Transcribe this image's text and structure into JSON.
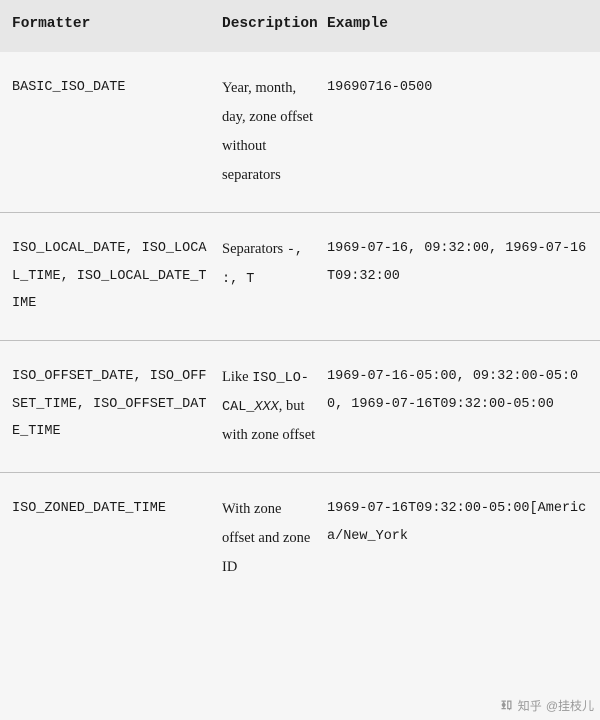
{
  "header": {
    "col1": "Formatter",
    "col2": "Description",
    "col3": "Example"
  },
  "rows": [
    {
      "formatter": "BASIC_ISO_DATE",
      "description_plain": "Year, month, day, zone offset without separators",
      "example": "19690716-0500"
    },
    {
      "formatter": "ISO_LOCAL_DATE, ISO_LOCAL_TIME, ISO_LOCAL_DATE_TIME",
      "desc_prefix": "Separators ",
      "desc_mono": "-, :, T",
      "example": "1969-07-16, 09:32:00, 1969-07-16T09:32:00"
    },
    {
      "formatter": "ISO_OFFSET_DATE, ISO_OFFSET_TIME, ISO_OFFSET_DATE_TIME",
      "desc_prefix": "Like ",
      "desc_mono": "ISO_LO-CAL_",
      "desc_mono_italic": "XXX",
      "desc_suffix": ", but with zone offset",
      "example": "1969-07-16-05:00, 09:32:00-05:00, 1969-07-16T09:32:00-05:00"
    },
    {
      "formatter": "ISO_ZONED_DATE_TIME",
      "description_plain": "With zone offset and zone ID",
      "example": "1969-07-16T09:32:00-05:00[America/New_York"
    }
  ],
  "watermark": {
    "source": "知乎",
    "author": "@挂枝儿"
  }
}
